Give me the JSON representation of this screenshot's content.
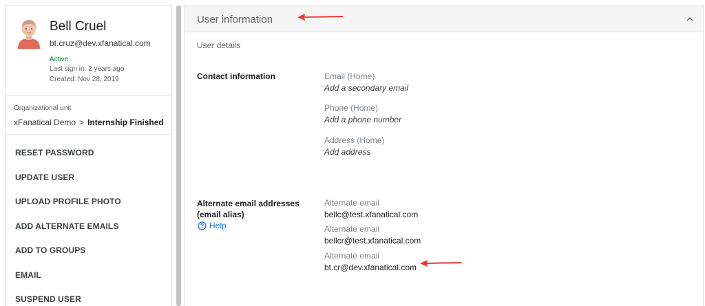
{
  "profile": {
    "name": "Bell Cruel",
    "email": "bt.cruz@dev.xfanatical.com",
    "status": "Active",
    "last_sign_in": "Last sign in: 2 years ago",
    "created": "Created: Nov 28, 2019"
  },
  "org_unit": {
    "label": "Organizational unit",
    "parent": "xFanatical Demo",
    "separator": ">",
    "current": "Internship Finished"
  },
  "actions": [
    "RESET PASSWORD",
    "UPDATE USER",
    "UPLOAD PROFILE PHOTO",
    "ADD ALTERNATE EMAILS",
    "ADD TO GROUPS",
    "EMAIL",
    "SUSPEND USER"
  ],
  "panel": {
    "title": "User information",
    "subtitle": "User details",
    "collapse_icon": "chevron-up-icon"
  },
  "contact": {
    "label": "Contact information",
    "email_label": "Email (Home)",
    "email_value": "Add a secondary email",
    "phone_label": "Phone (Home)",
    "phone_value": "Add a phone number",
    "address_label": "Address (Home)",
    "address_value": "Add address"
  },
  "alternate": {
    "label": "Alternate email addresses (email alias)",
    "help": "Help",
    "help_icon": "help-circle-icon",
    "entries": [
      {
        "label": "Alternate email",
        "value": "bellc@test.xfanatical.com"
      },
      {
        "label": "Alternate email",
        "value": "bellcr@test.xfanatical.com"
      },
      {
        "label": "Alternate email",
        "value": "bt.cr@dev.xfanatical.com"
      }
    ]
  },
  "colors": {
    "active": "#188038",
    "link": "#1a73e8",
    "annotation_arrow": "#e53935",
    "header_bg": "#f5f5f5"
  }
}
